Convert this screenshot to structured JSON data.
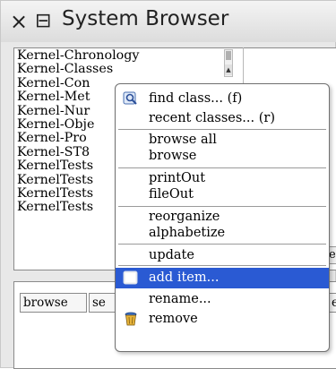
{
  "window": {
    "title": "System Browser",
    "close_glyph": "×",
    "menu_glyph": "⊟"
  },
  "packages": [
    "Kernel-Chronology",
    "Kernel-Classes",
    "Kernel-Con",
    "Kernel-Met",
    "Kernel-Nur",
    "Kernel-Obje",
    "Kernel-Pro",
    "Kernel-ST8",
    "KernelTests",
    "KernelTests",
    "KernelTests",
    "KernelTests"
  ],
  "buttons": {
    "browse": "browse",
    "se": "se",
    "right_fragment": "er",
    "right_upper_fragment": "e"
  },
  "context_menu": {
    "items": [
      {
        "label": "find class... (f)",
        "icon": "find-class-icon"
      },
      {
        "label": "recent classes... (r)"
      },
      {
        "label": "browse all"
      },
      {
        "label": "browse"
      },
      {
        "label": "printOut"
      },
      {
        "label": "fileOut"
      },
      {
        "label": "reorganize"
      },
      {
        "label": "alphabetize"
      },
      {
        "label": "update"
      },
      {
        "label": "add item...",
        "icon": "add-item-icon",
        "selected": true
      },
      {
        "label": "rename..."
      },
      {
        "label": "remove",
        "icon": "trash-can-icon"
      }
    ]
  },
  "colors": {
    "selection": "#2a5ad3"
  }
}
